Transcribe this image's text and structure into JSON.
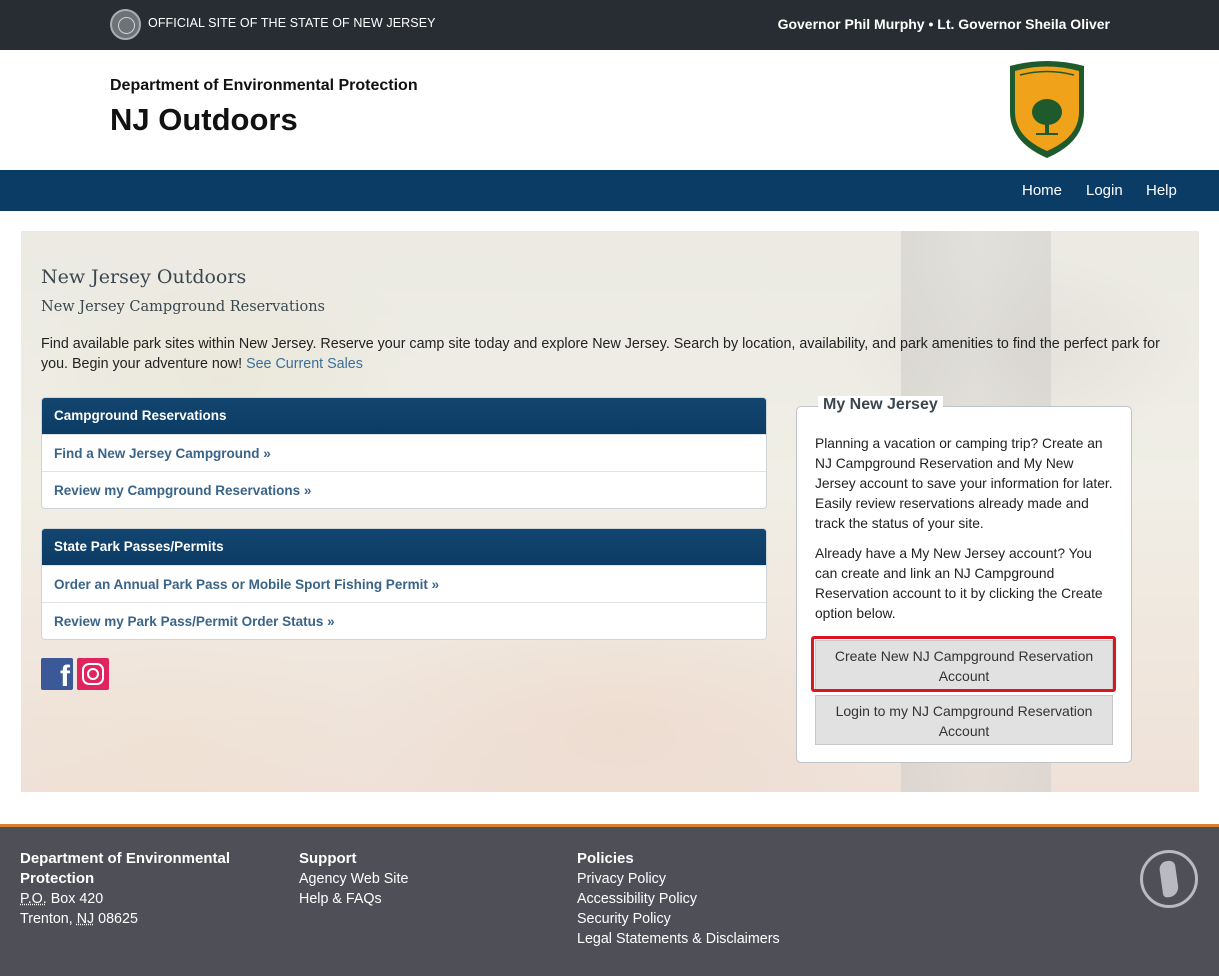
{
  "topbar": {
    "official_text": "OFFICIAL SITE OF THE STATE OF NEW JERSEY",
    "governor_text": "Governor Phil Murphy • Lt. Governor Sheila Oliver"
  },
  "header": {
    "department": "Department of Environmental Protection",
    "title": "NJ Outdoors",
    "badge_icon": "state-park-service-badge"
  },
  "nav": {
    "home": "Home",
    "login": "Login",
    "help": "Help"
  },
  "main": {
    "heading": "New Jersey Outdoors",
    "subheading": "New Jersey Campground Reservations",
    "intro": "Find available park sites within New Jersey. Reserve your camp site today and explore New Jersey. Search by location, availability, and park amenities to find the perfect park for you. Begin your adventure now!",
    "sales_link": "See Current Sales"
  },
  "campground_panel": {
    "title": "Campground Reservations",
    "items": [
      {
        "label": "Find a New Jersey Campground »"
      },
      {
        "label": "Review my Campground Reservations »"
      }
    ]
  },
  "passes_panel": {
    "title": "State Park Passes/Permits",
    "items": [
      {
        "label": "Order an Annual Park Pass or Mobile Sport Fishing Permit »"
      },
      {
        "label": "Review my Park Pass/Permit Order Status »"
      }
    ]
  },
  "social": {
    "facebook_glyph": "f"
  },
  "my_nj": {
    "legend": "My New Jersey",
    "para1": "Planning a vacation or camping trip? Create an NJ Campground Reservation and My New Jersey account to save your information for later. Easily review reservations already made and track the status of your site.",
    "para2": "Already have a My New Jersey account? You can create and link an NJ Campground Reservation account to it by clicking the Create option below.",
    "create_button": "Create New NJ Campground Reservation Account",
    "login_button": "Login to my NJ Campground Reservation Account",
    "highlight_color": "#e0141e"
  },
  "footer": {
    "dept_heading": "Department of Environmental Protection",
    "address_po": "P.O.",
    "address_box": " Box 420",
    "address_city": "Trenton, ",
    "address_state": "NJ",
    "address_zip": " 08625",
    "support_heading": "Support",
    "support_links": [
      "Agency Web Site",
      "Help & FAQs"
    ],
    "policies_heading": "Policies",
    "policy_links": [
      "Privacy Policy",
      "Accessibility Policy",
      "Security Policy",
      "Legal Statements & Disclaimers"
    ]
  },
  "colors": {
    "topbar": "#282d33",
    "nav": "#0b3c66",
    "footer": "#4e4f57",
    "footer_accent": "#d9822b"
  }
}
